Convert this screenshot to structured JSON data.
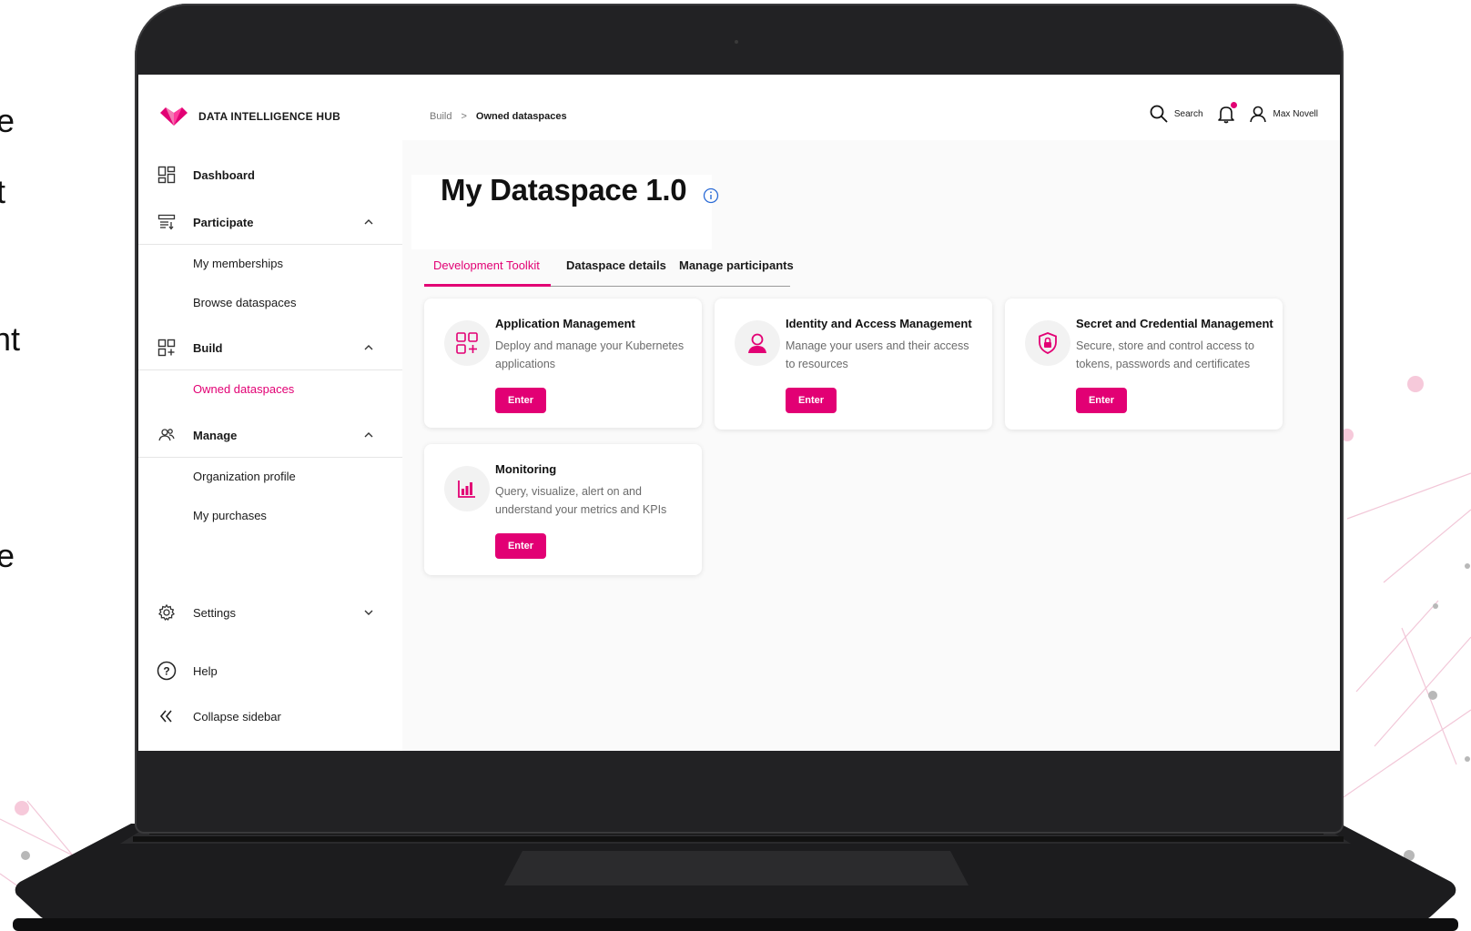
{
  "background": {
    "edge_letters": [
      "e",
      "t",
      "nt",
      "e"
    ]
  },
  "app": {
    "logo_text": "DATA INTELLIGENCE HUB",
    "accent_color": "#e20074"
  },
  "breadcrumb": {
    "items": [
      "Build",
      "Owned dataspaces"
    ],
    "separator": ">"
  },
  "topbar": {
    "search_label": "Search",
    "user_name": "Max Novell",
    "notification_badge": true
  },
  "sidebar": {
    "dashboard": "Dashboard",
    "participate": "Participate",
    "participate_items": [
      "My memberships",
      "Browse dataspaces"
    ],
    "build": "Build",
    "build_items": [
      "Owned dataspaces"
    ],
    "manage": "Manage",
    "manage_items": [
      "Organization profile",
      "My purchases"
    ],
    "settings": "Settings",
    "help": "Help",
    "collapse": "Collapse sidebar"
  },
  "main": {
    "title": "My Dataspace 1.0",
    "tabs": [
      "Development Toolkit",
      "Dataspace details",
      "Manage participants"
    ],
    "active_tab": "Development Toolkit",
    "cards": [
      {
        "title": "Application Management",
        "description": "Deploy and manage your Kubernetes applications",
        "button": "Enter",
        "icon": "apps-add-icon"
      },
      {
        "title": "Identity and Access Management",
        "description": "Manage your users and their access to resources",
        "button": "Enter",
        "icon": "user-icon"
      },
      {
        "title": "Secret and Credential Management",
        "description": "Secure, store and control access to tokens, passwords and certificates",
        "button": "Enter",
        "icon": "shield-lock-icon"
      },
      {
        "title": "Monitoring",
        "description": "Query, visualize, alert on and understand your metrics and KPIs",
        "button": "Enter",
        "icon": "bar-chart-icon"
      }
    ]
  }
}
